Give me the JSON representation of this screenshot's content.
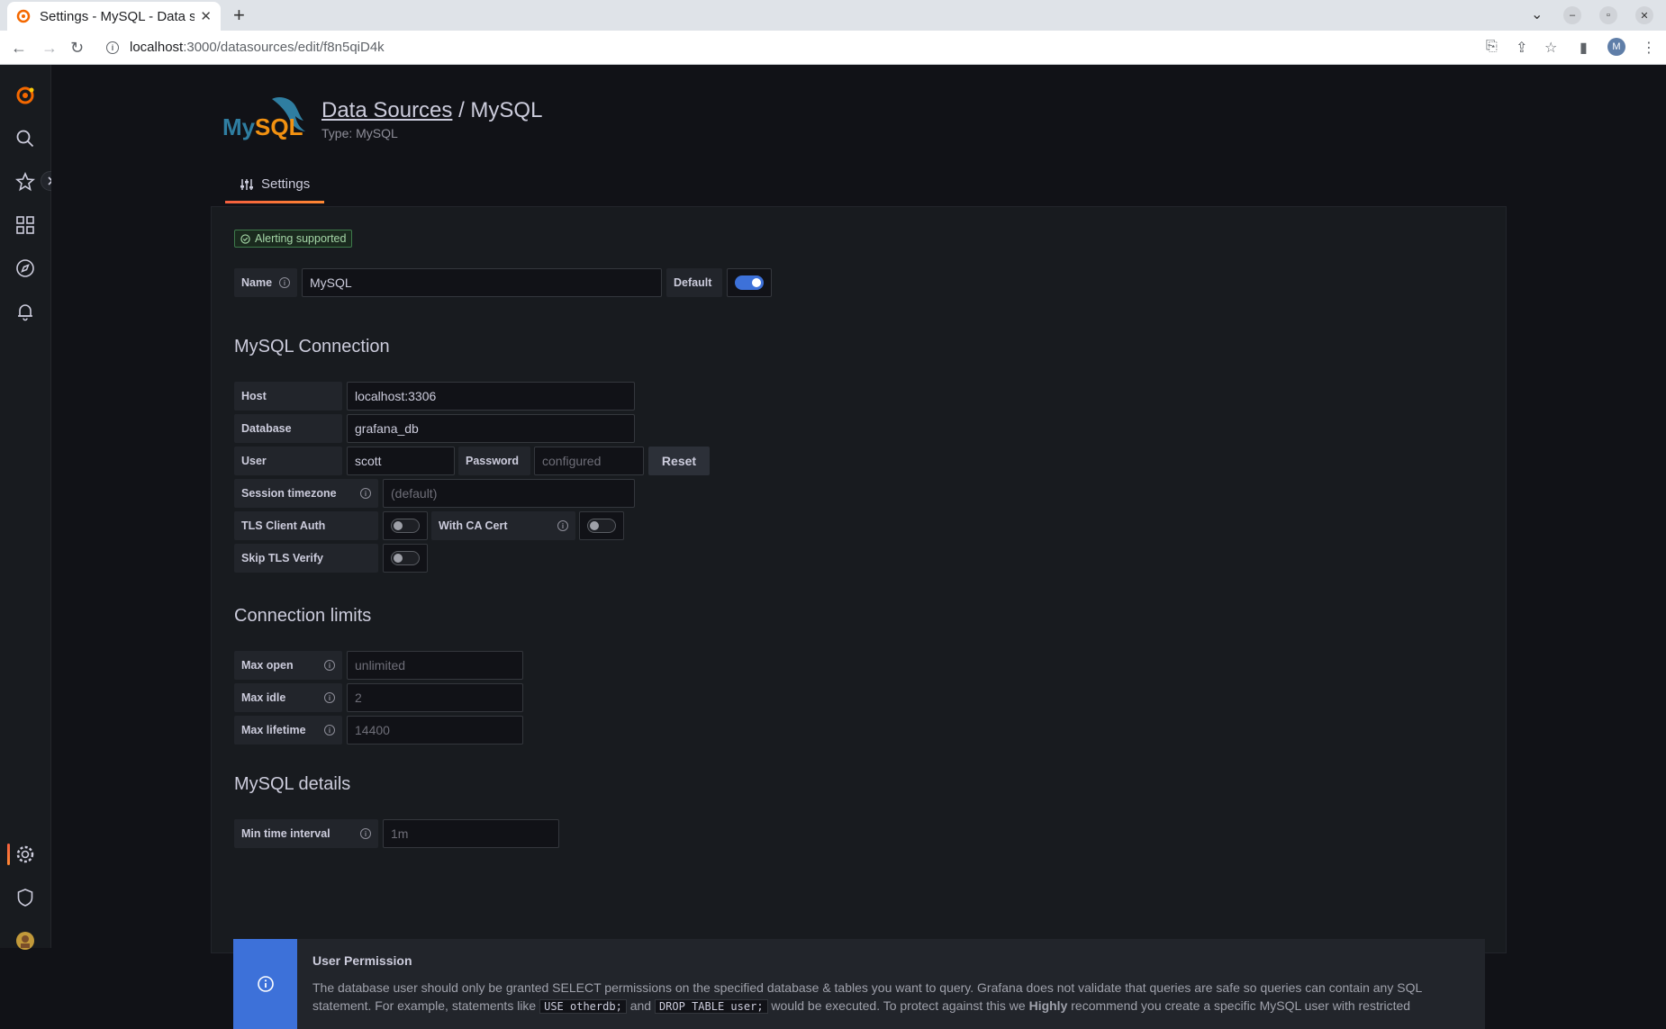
{
  "browser": {
    "tab_title": "Settings - MySQL - Data so",
    "new_tab": "+",
    "url_host": "localhost",
    "url_path": ":3000/datasources/edit/f8n5qiD4k",
    "profile_initial": "M"
  },
  "header": {
    "breadcrumb_link": "Data Sources",
    "breadcrumb_sep": " / ",
    "breadcrumb_current": "MySQL",
    "subtitle": "Type: MySQL"
  },
  "tabs": [
    {
      "label": "Settings"
    }
  ],
  "form": {
    "badge": "Alerting supported",
    "name_label": "Name",
    "name_value": "MySQL",
    "default_label": "Default",
    "default_on": true
  },
  "connection": {
    "title": "MySQL Connection",
    "host_label": "Host",
    "host_value": "localhost:3306",
    "database_label": "Database",
    "database_value": "grafana_db",
    "user_label": "User",
    "user_value": "scott",
    "password_label": "Password",
    "password_placeholder": "configured",
    "reset_label": "Reset",
    "tz_label": "Session timezone",
    "tz_placeholder": "(default)",
    "tls_client_label": "TLS Client Auth",
    "ca_cert_label": "With CA Cert",
    "skip_tls_label": "Skip TLS Verify"
  },
  "limits": {
    "title": "Connection limits",
    "max_open_label": "Max open",
    "max_open_placeholder": "unlimited",
    "max_idle_label": "Max idle",
    "max_idle_placeholder": "2",
    "max_lifetime_label": "Max lifetime",
    "max_lifetime_placeholder": "14400"
  },
  "details": {
    "title": "MySQL details",
    "min_interval_label": "Min time interval",
    "min_interval_placeholder": "1m"
  },
  "permission": {
    "title": "User Permission",
    "text1": "The database user should only be granted SELECT permissions on the specified database & tables you want to query. Grafana does not validate that queries are safe so queries can contain any SQL statement. For example, statements like ",
    "code1": "USE otherdb;",
    "and": " and ",
    "code2": "DROP TABLE user;",
    "text2": " would be executed. To protect against this we ",
    "highly": "Highly",
    "text3": " recommend you create a specific MySQL user with restricted"
  }
}
